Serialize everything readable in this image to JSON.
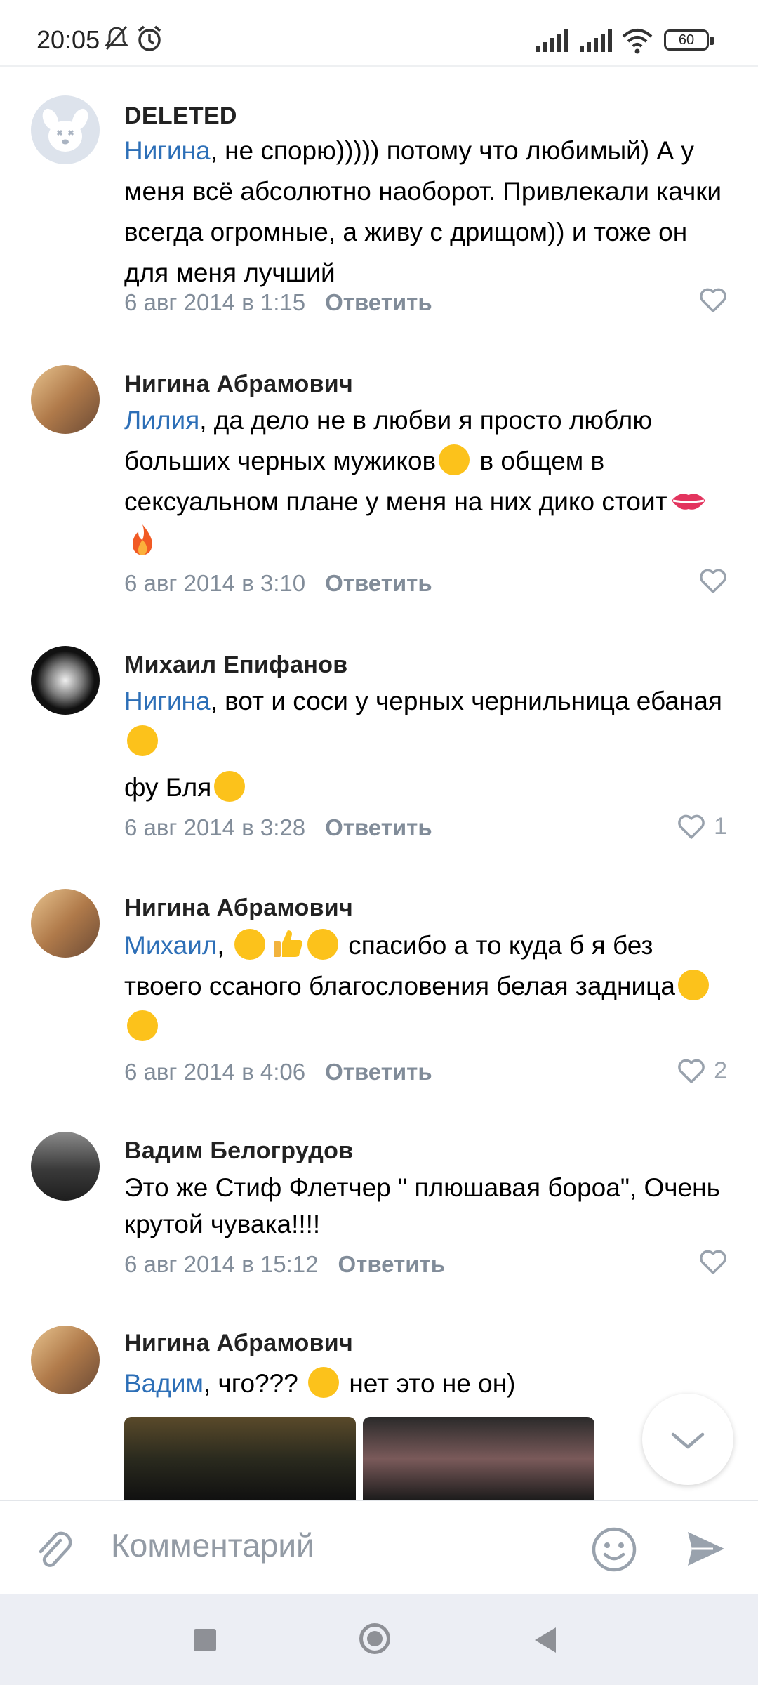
{
  "status": {
    "time": "20:05",
    "battery": "60"
  },
  "comments": [
    {
      "author": "DELETED",
      "mention": "Нигина",
      "text": ", не спорю))))) потому что любимый) А у меня всё абсолютно наоборот. Привлекали качки всегда огромные, а живу с дрищом)) и тоже он для меня лучший",
      "date": "6 авг 2014 в 1:15",
      "reply": "Ответить",
      "likes": ""
    },
    {
      "author": "Нигина Абрамович",
      "mention": "Лилия",
      "text_1": ", да дело не в любви я просто люблю больших черных мужиков",
      "text_2": " в общем в сексуальном плане у меня на них дико стоит",
      "date": "6 авг 2014 в 3:10",
      "reply": "Ответить",
      "likes": ""
    },
    {
      "author": "Михаил Епифанов",
      "mention": "Нигина",
      "text_1": ", вот и соси у черных чернильница ебаная",
      "text_2": "фу Бля",
      "date": "6 авг 2014 в 3:28",
      "reply": "Ответить",
      "likes": "1"
    },
    {
      "author": "Нигина Абрамович",
      "mention": "Михаил",
      "text_1": ",",
      "text_2": " спасибо а то куда б я без твоего ссаного благословения белая задница",
      "date": "6 авг 2014 в 4:06",
      "reply": "Ответить",
      "likes": "2"
    },
    {
      "author": "Вадим Белогрудов",
      "text": "Это же Стиф Флетчер \" плюшавая бороа\", Очень крутой чувака!!!!",
      "date": "6 авг 2014 в 15:12",
      "reply": "Ответить",
      "likes": ""
    },
    {
      "author": "Нигина Абрамович",
      "mention": "Вадим",
      "text_1": ", чго???",
      "text_2": " нет это не он)"
    }
  ],
  "composer": {
    "placeholder": "Комментарий"
  },
  "colors": {
    "accent": "#2d6fb7",
    "meta": "#818c99",
    "icon": "#99a2ad"
  }
}
